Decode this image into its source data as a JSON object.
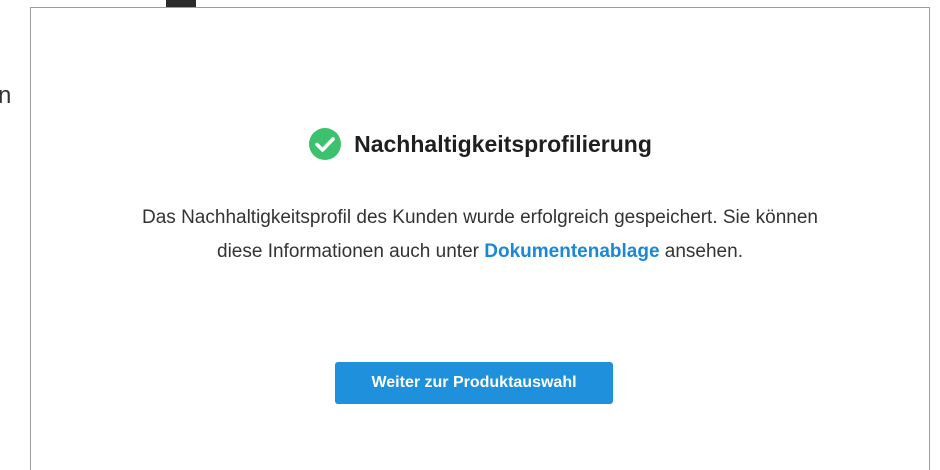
{
  "background": {
    "fragment_text": "n"
  },
  "modal": {
    "title": "Nachhaltigkeitsprofilierung",
    "status_icon": "check-circle-icon",
    "message_line1": "Das Nachhaltigkeitsprofil des Kunden wurde erfolgreich gespeichert. Sie können",
    "message_line2_before": "diese Informationen auch unter ",
    "link_label": "Dokumentenablage",
    "message_line2_after": " ansehen.",
    "primary_button_label": "Weiter zur Produktauswahl"
  },
  "colors": {
    "success": "#3cc26f",
    "link": "#1a88d6",
    "primary_button": "#1e90dc",
    "border": "#9e9e9e"
  }
}
